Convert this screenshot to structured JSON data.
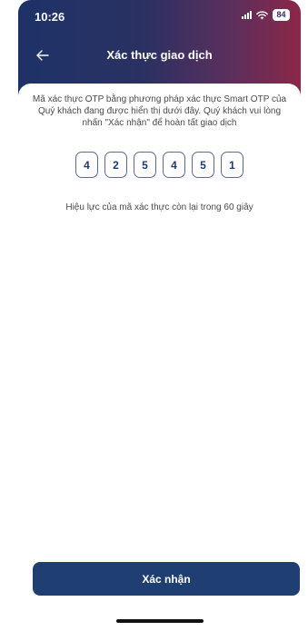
{
  "status_bar": {
    "time": "10:26",
    "battery": "84"
  },
  "header": {
    "title": "Xác thực giao dịch",
    "back_icon": "arrow-left-icon"
  },
  "content": {
    "instruction": "Mã xác thực OTP bằng phương pháp xác thực Smart OTP của Quý khách đang được hiển thị dưới đây. Quý khách vui lòng nhấn \"Xác nhận\" để hoàn tất giao dịch",
    "otp_digits": [
      "4",
      "2",
      "5",
      "4",
      "5",
      "1"
    ],
    "validity": "Hiệu lực của mã xác thực còn lại trong 60 giây"
  },
  "footer": {
    "confirm_label": "Xác nhận"
  },
  "colors": {
    "header_gradient_start": "#1d3268",
    "header_gradient_end": "#8c2748",
    "primary_button": "#1f3f73",
    "otp_text": "#1f3a6f"
  }
}
